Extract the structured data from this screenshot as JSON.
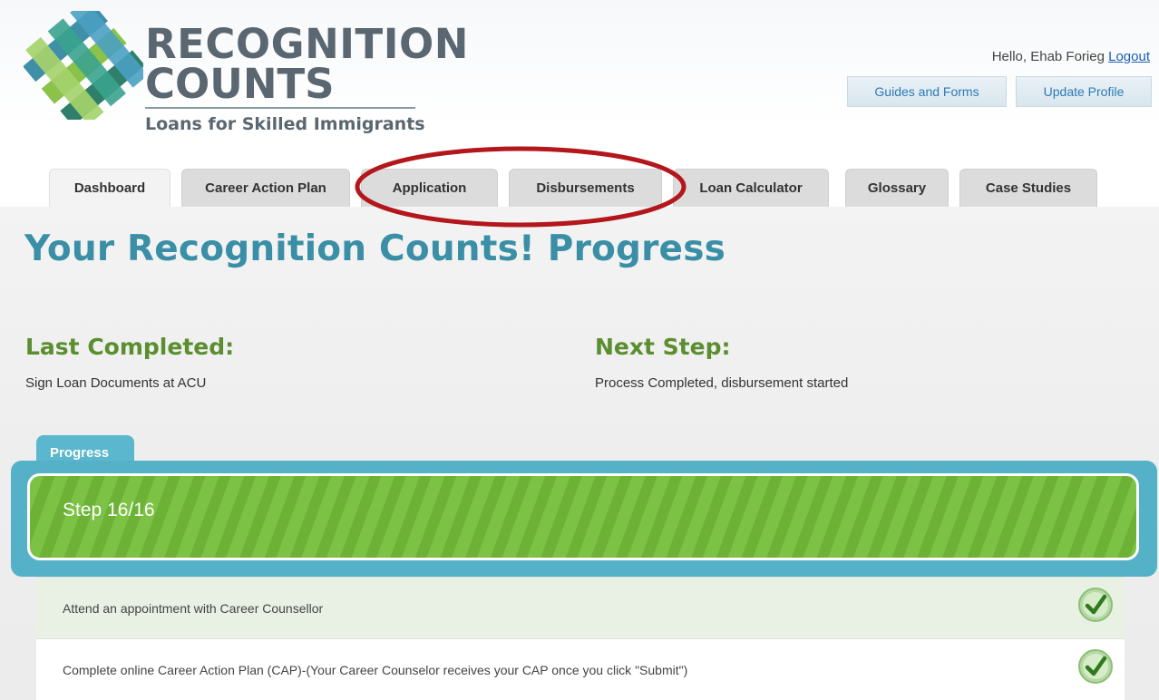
{
  "header": {
    "logo_line1": "RECOGNITION",
    "logo_line2": "COUNTS",
    "logo_tagline": "Loans for Skilled Immigrants",
    "greeting": "Hello, Ehab Forieg",
    "logout": "Logout",
    "guides_button": "Guides and Forms",
    "profile_button": "Update Profile"
  },
  "tabs": [
    {
      "label": "Dashboard",
      "active": true
    },
    {
      "label": "Career Action Plan",
      "active": false
    },
    {
      "label": "Application",
      "active": false
    },
    {
      "label": "Disbursements",
      "active": false
    },
    {
      "label": "Loan Calculator",
      "active": false
    },
    {
      "label": "Glossary",
      "active": false
    },
    {
      "label": "Case Studies",
      "active": false
    }
  ],
  "main": {
    "title": "Your Recognition Counts! Progress",
    "last_completed_heading": "Last Completed:",
    "last_completed_value": "Sign Loan Documents at ACU",
    "next_step_heading": "Next Step:",
    "next_step_value": "Process Completed, disbursement started"
  },
  "progress": {
    "tab_label": "Progress",
    "step_label": "Step 16/16",
    "current": 16,
    "total": 16,
    "fraction": 1.0
  },
  "steps": [
    {
      "label": "Attend an appointment with Career Counsellor",
      "completed": true
    },
    {
      "label": "Complete online Career Action Plan (CAP)-(Your Career Counselor receives your CAP once you click \"Submit\")",
      "completed": true
    }
  ],
  "colors": {
    "title_teal": "#3a8fa6",
    "heading_green": "#5a8e2f",
    "progress_green": "#7cc244",
    "frame_blue": "#54b1c8",
    "annotation_red": "#b3161b",
    "link_blue": "#1a5fb4"
  },
  "icons": {
    "check": "check-circle-icon",
    "logo": "logo-mark-icon"
  }
}
